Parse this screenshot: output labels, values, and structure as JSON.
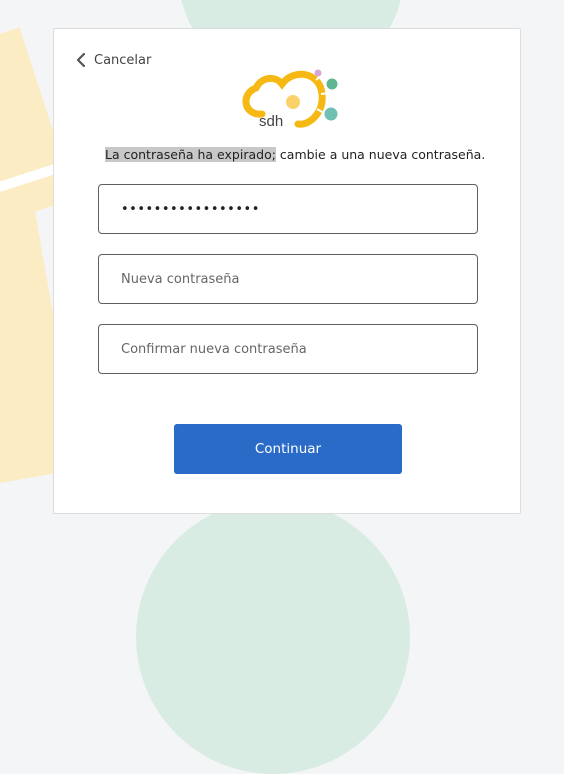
{
  "card": {
    "cancel_label": "Cancelar",
    "logo_text": "sdh",
    "message_highlight": "La contraseña ha expirado;",
    "message_rest": " cambie a una nueva contraseña."
  },
  "form": {
    "current_password": {
      "value": "•••••••••••••••••",
      "placeholder": ""
    },
    "new_password": {
      "value": "",
      "placeholder": "Nueva contraseña"
    },
    "confirm_password": {
      "value": "",
      "placeholder": "Confirmar nueva contraseña"
    },
    "continue_label": "Continuar"
  },
  "colors": {
    "primary_button": "#2a6bc7",
    "logo_yellow": "#f6b914",
    "logo_teal": "#6fbfb3",
    "logo_green": "#5fb58f",
    "logo_pink": "#d6a7d6"
  },
  "icons": {
    "back": "chevron-left-icon"
  }
}
